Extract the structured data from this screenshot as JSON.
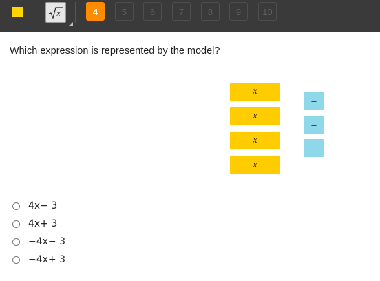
{
  "toolbar": {
    "flag_icon": "flag-icon",
    "calculator_icon": "square-root-icon",
    "question_numbers": [
      "4",
      "5",
      "6",
      "7",
      "8",
      "9",
      "10"
    ],
    "active_question": "4",
    "accent_color": "#ff8c00"
  },
  "question": {
    "prompt": "Which expression is represented by the model?"
  },
  "model": {
    "x_tiles": [
      "x",
      "x",
      "x",
      "x"
    ],
    "unit_tiles": [
      "–",
      "–",
      "–"
    ],
    "x_tile_color": "#ffcc00",
    "unit_tile_color": "#8ed8ea"
  },
  "options": [
    {
      "label": "4x− 3"
    },
    {
      "label": "4x+ 3"
    },
    {
      "label": "−4x− 3"
    },
    {
      "label": "−4x+ 3"
    }
  ]
}
